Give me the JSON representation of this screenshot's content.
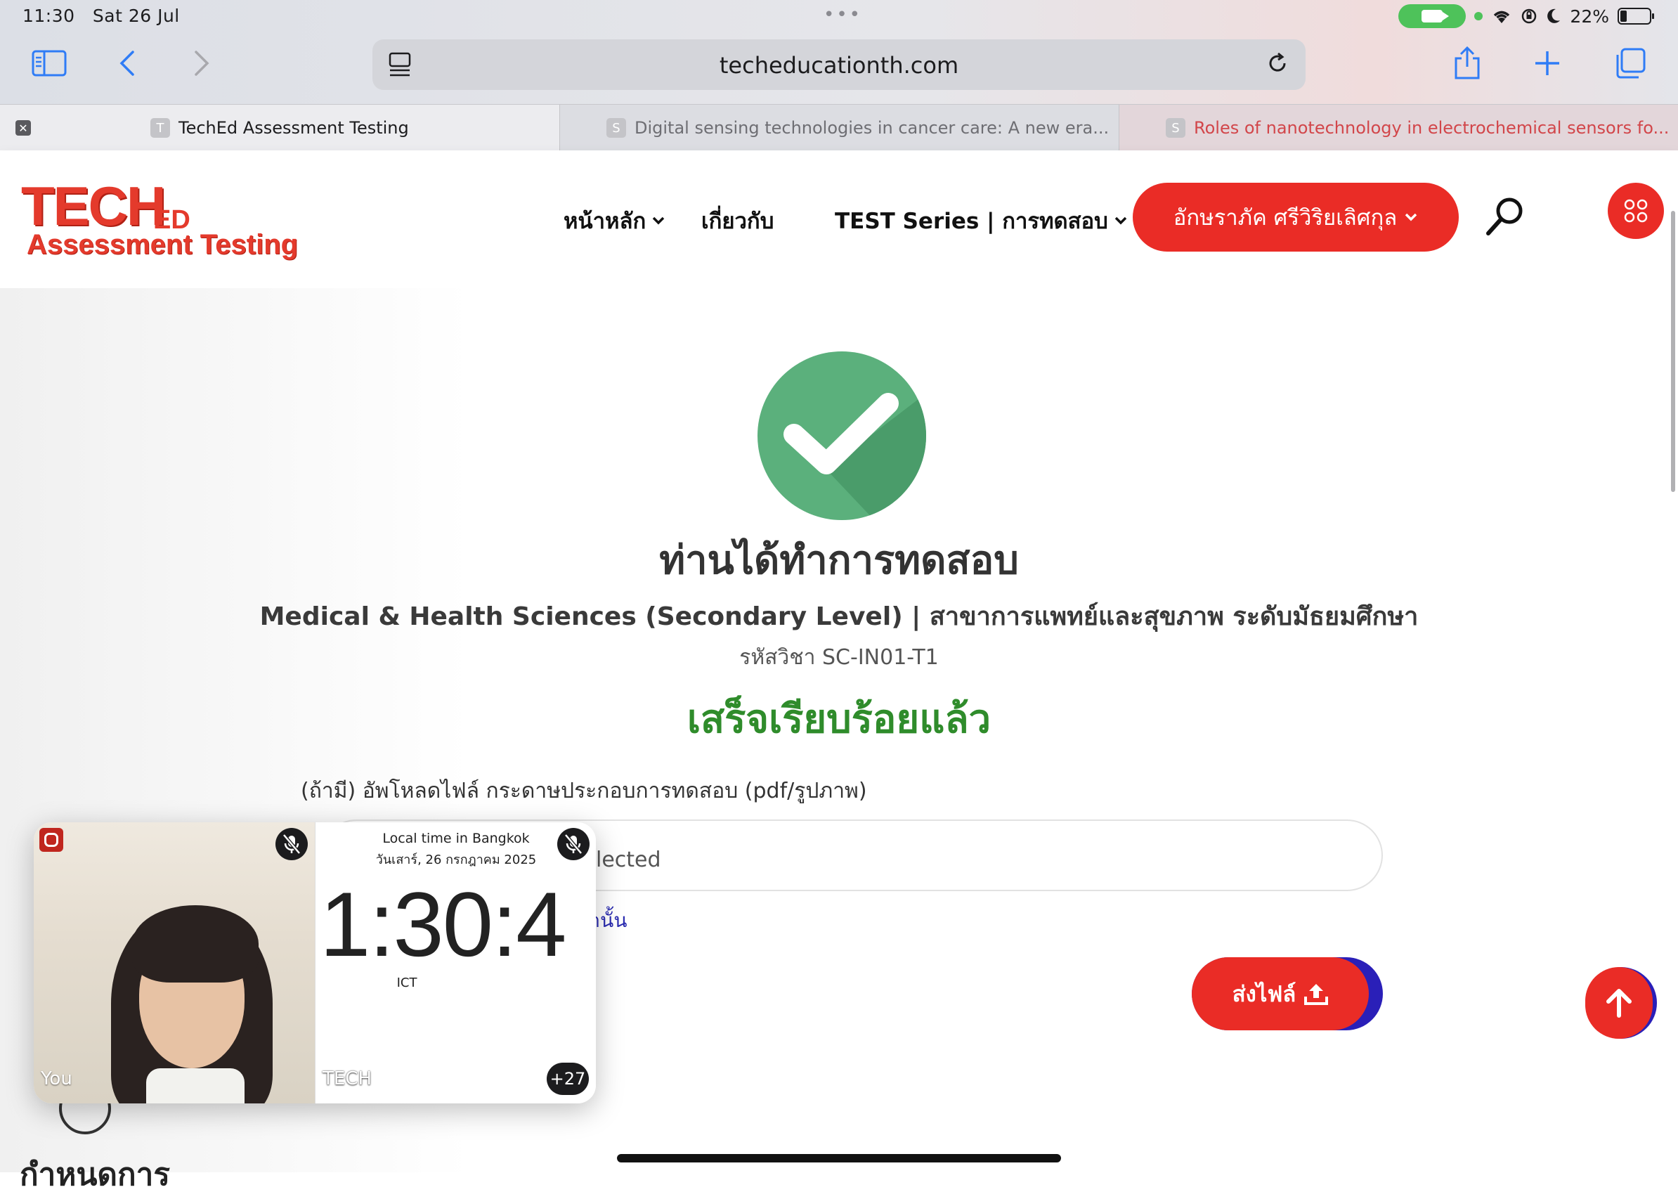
{
  "status_bar": {
    "time": "11:30",
    "date": "Sat 26 Jul",
    "battery": "22%",
    "battery_level": 0.22
  },
  "browser": {
    "url": "techeducationth.com",
    "tabs": [
      {
        "favicon": "T",
        "title": "TechEd Assessment Testing",
        "active": true
      },
      {
        "favicon": "S",
        "title": "Digital sensing technologies in cancer care: A new era..."
      },
      {
        "favicon": "S",
        "title": "Roles of nanotechnology in electrochemical sensors fo..."
      }
    ]
  },
  "site": {
    "logo": {
      "main": "TECH",
      "sub": "Assessment Testing",
      "accent": "ED"
    },
    "nav": [
      {
        "label": "หน้าหลัก",
        "has_dropdown": true
      },
      {
        "label": "เกี่ยวกับ",
        "has_dropdown": false
      },
      {
        "label": "TEST Series | การทดสอบ",
        "has_dropdown": true
      }
    ],
    "user_name": "อักษราภัค ศรีวิริยเลิศกุล",
    "colors": {
      "brand_red": "#ea2c26",
      "success_green": "#2f8c2b",
      "check_green": "#5bb07c",
      "link_blue": "#2a2bb0"
    }
  },
  "main": {
    "heading": "ท่านได้ทำการทดสอบ",
    "course": "Medical & Health Sciences (Secondary Level) | สาขาการแพทย์และสุขภาพ ระดับมัธยมศึกษา",
    "course_code": "รหัสวิชา SC-IN01-T1",
    "status": "เสร็จเรียบร้อยแล้ว",
    "upload_label": "(ถ้ามี) อัพโหลดไฟล์ กระดาษประกอบการทดสอบ (pdf/รูปภาพ)",
    "file_field_text": "lected",
    "note_text": "ท่านั้น",
    "send_button": "ส่งไฟล์",
    "below_title": "กำหนดการ"
  },
  "facetime": {
    "self_label": "You",
    "local_time_label": "Local time in Bangkok",
    "local_date": "วันเสาร์, 26 กรกฎาคม 2025",
    "clock": "1:30:4",
    "timezone": "ICT",
    "caller_label": "TECH",
    "extra_participants": "+27"
  }
}
